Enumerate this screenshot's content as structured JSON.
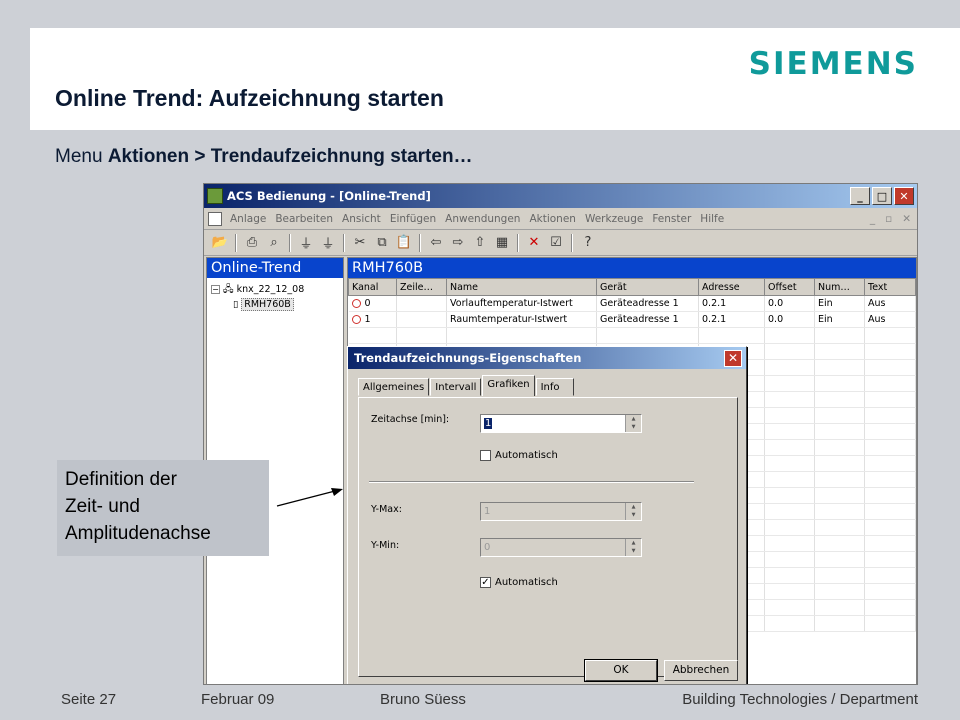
{
  "slide": {
    "logo": "SIEMENS",
    "title": "Online Trend: Aufzeichnung starten",
    "subtitle_prefix": "Menu ",
    "subtitle_bold": "Aktionen > Trendaufzeichnung starten…",
    "callout": [
      "Definition der",
      "Zeit- und",
      "Amplitudenachse"
    ]
  },
  "footer": {
    "page": "Seite 27",
    "date": "Februar 09",
    "author": "Bruno Süess",
    "department": "Building Technologies / Department"
  },
  "window": {
    "title": "ACS Bedienung - [Online-Trend]",
    "menu": [
      "Anlage",
      "Bearbeiten",
      "Ansicht",
      "Einfügen",
      "Anwendungen",
      "Aktionen",
      "Werkzeuge",
      "Fenster",
      "Hilfe"
    ],
    "left_pane_title": "Online-Trend",
    "tree": {
      "root": "knx_22_12_08",
      "child": "RMH760B"
    },
    "right_pane_title": "RMH760B",
    "columns": [
      "Kanal",
      "Zeile…",
      "Name",
      "Gerät",
      "Adresse",
      "Offset",
      "Num…",
      "Text"
    ],
    "rows": [
      {
        "kanal": "0",
        "zeile": "",
        "name": "Vorlauftemperatur-Istwert",
        "geraet": "Geräteadresse 1",
        "adresse": "0.2.1",
        "offset": "0.0",
        "num": "Ein",
        "text": "Aus"
      },
      {
        "kanal": "1",
        "zeile": "",
        "name": "Raumtemperatur-Istwert",
        "geraet": "Geräteadresse 1",
        "adresse": "0.2.1",
        "offset": "0.0",
        "num": "Ein",
        "text": "Aus"
      }
    ]
  },
  "dialog": {
    "title": "Trendaufzeichnungs-Eigenschaften",
    "tabs": [
      "Allgemeines",
      "Intervall",
      "Grafiken",
      "Info"
    ],
    "active_tab": "Grafiken",
    "zeitachse_label": "Zeitachse [min]:",
    "zeitachse_value": "1",
    "auto1_label": "Automatisch",
    "auto1_checked": false,
    "ymax_label": "Y-Max:",
    "ymax_value": "1",
    "ymin_label": "Y-Min:",
    "ymin_value": "0",
    "auto2_label": "Automatisch",
    "auto2_checked": true,
    "ok_label": "OK",
    "cancel_label": "Abbrechen"
  },
  "colors": {
    "brand": "#0f9a9a",
    "pane_header": "#0844cc",
    "titlebar": "#0a246a"
  }
}
